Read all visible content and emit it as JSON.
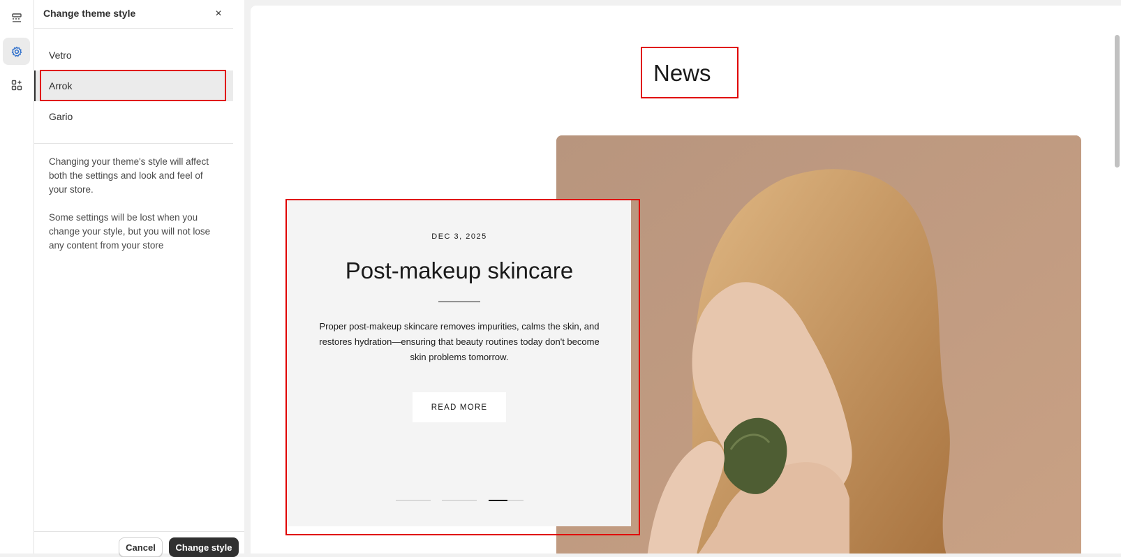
{
  "panel": {
    "title": "Change theme style",
    "close_label": "×",
    "styles": [
      {
        "label": "Vetro",
        "selected": false
      },
      {
        "label": "Arrok",
        "selected": true
      },
      {
        "label": "Gario",
        "selected": false
      }
    ],
    "description_1": "Changing your theme's style will affect both the settings and look and feel of your store.",
    "description_2": "Some settings will be lost when you change your style, but you will not lose any content from your store",
    "cancel_label": "Cancel",
    "confirm_label": "Change style"
  },
  "rail": {
    "items": [
      {
        "icon": "sections-icon",
        "active": false
      },
      {
        "icon": "settings-icon",
        "active": true
      },
      {
        "icon": "apps-icon",
        "active": false
      }
    ]
  },
  "preview": {
    "section_title": "News",
    "article": {
      "date": "DEC 3, 2025",
      "title": "Post-makeup skincare",
      "excerpt": "Proper post-makeup skincare removes impurities, calms the skin, and restores hydration—ensuring that beauty routines today don't become skin problems tomorrow.",
      "button_label": "READ MORE"
    },
    "slider": {
      "count": 3,
      "active_index": 2
    }
  },
  "colors": {
    "highlight": "#e00000",
    "primary_button": "#303030",
    "card_bg": "#f4f4f4",
    "photo_bg": "#c49b80"
  }
}
